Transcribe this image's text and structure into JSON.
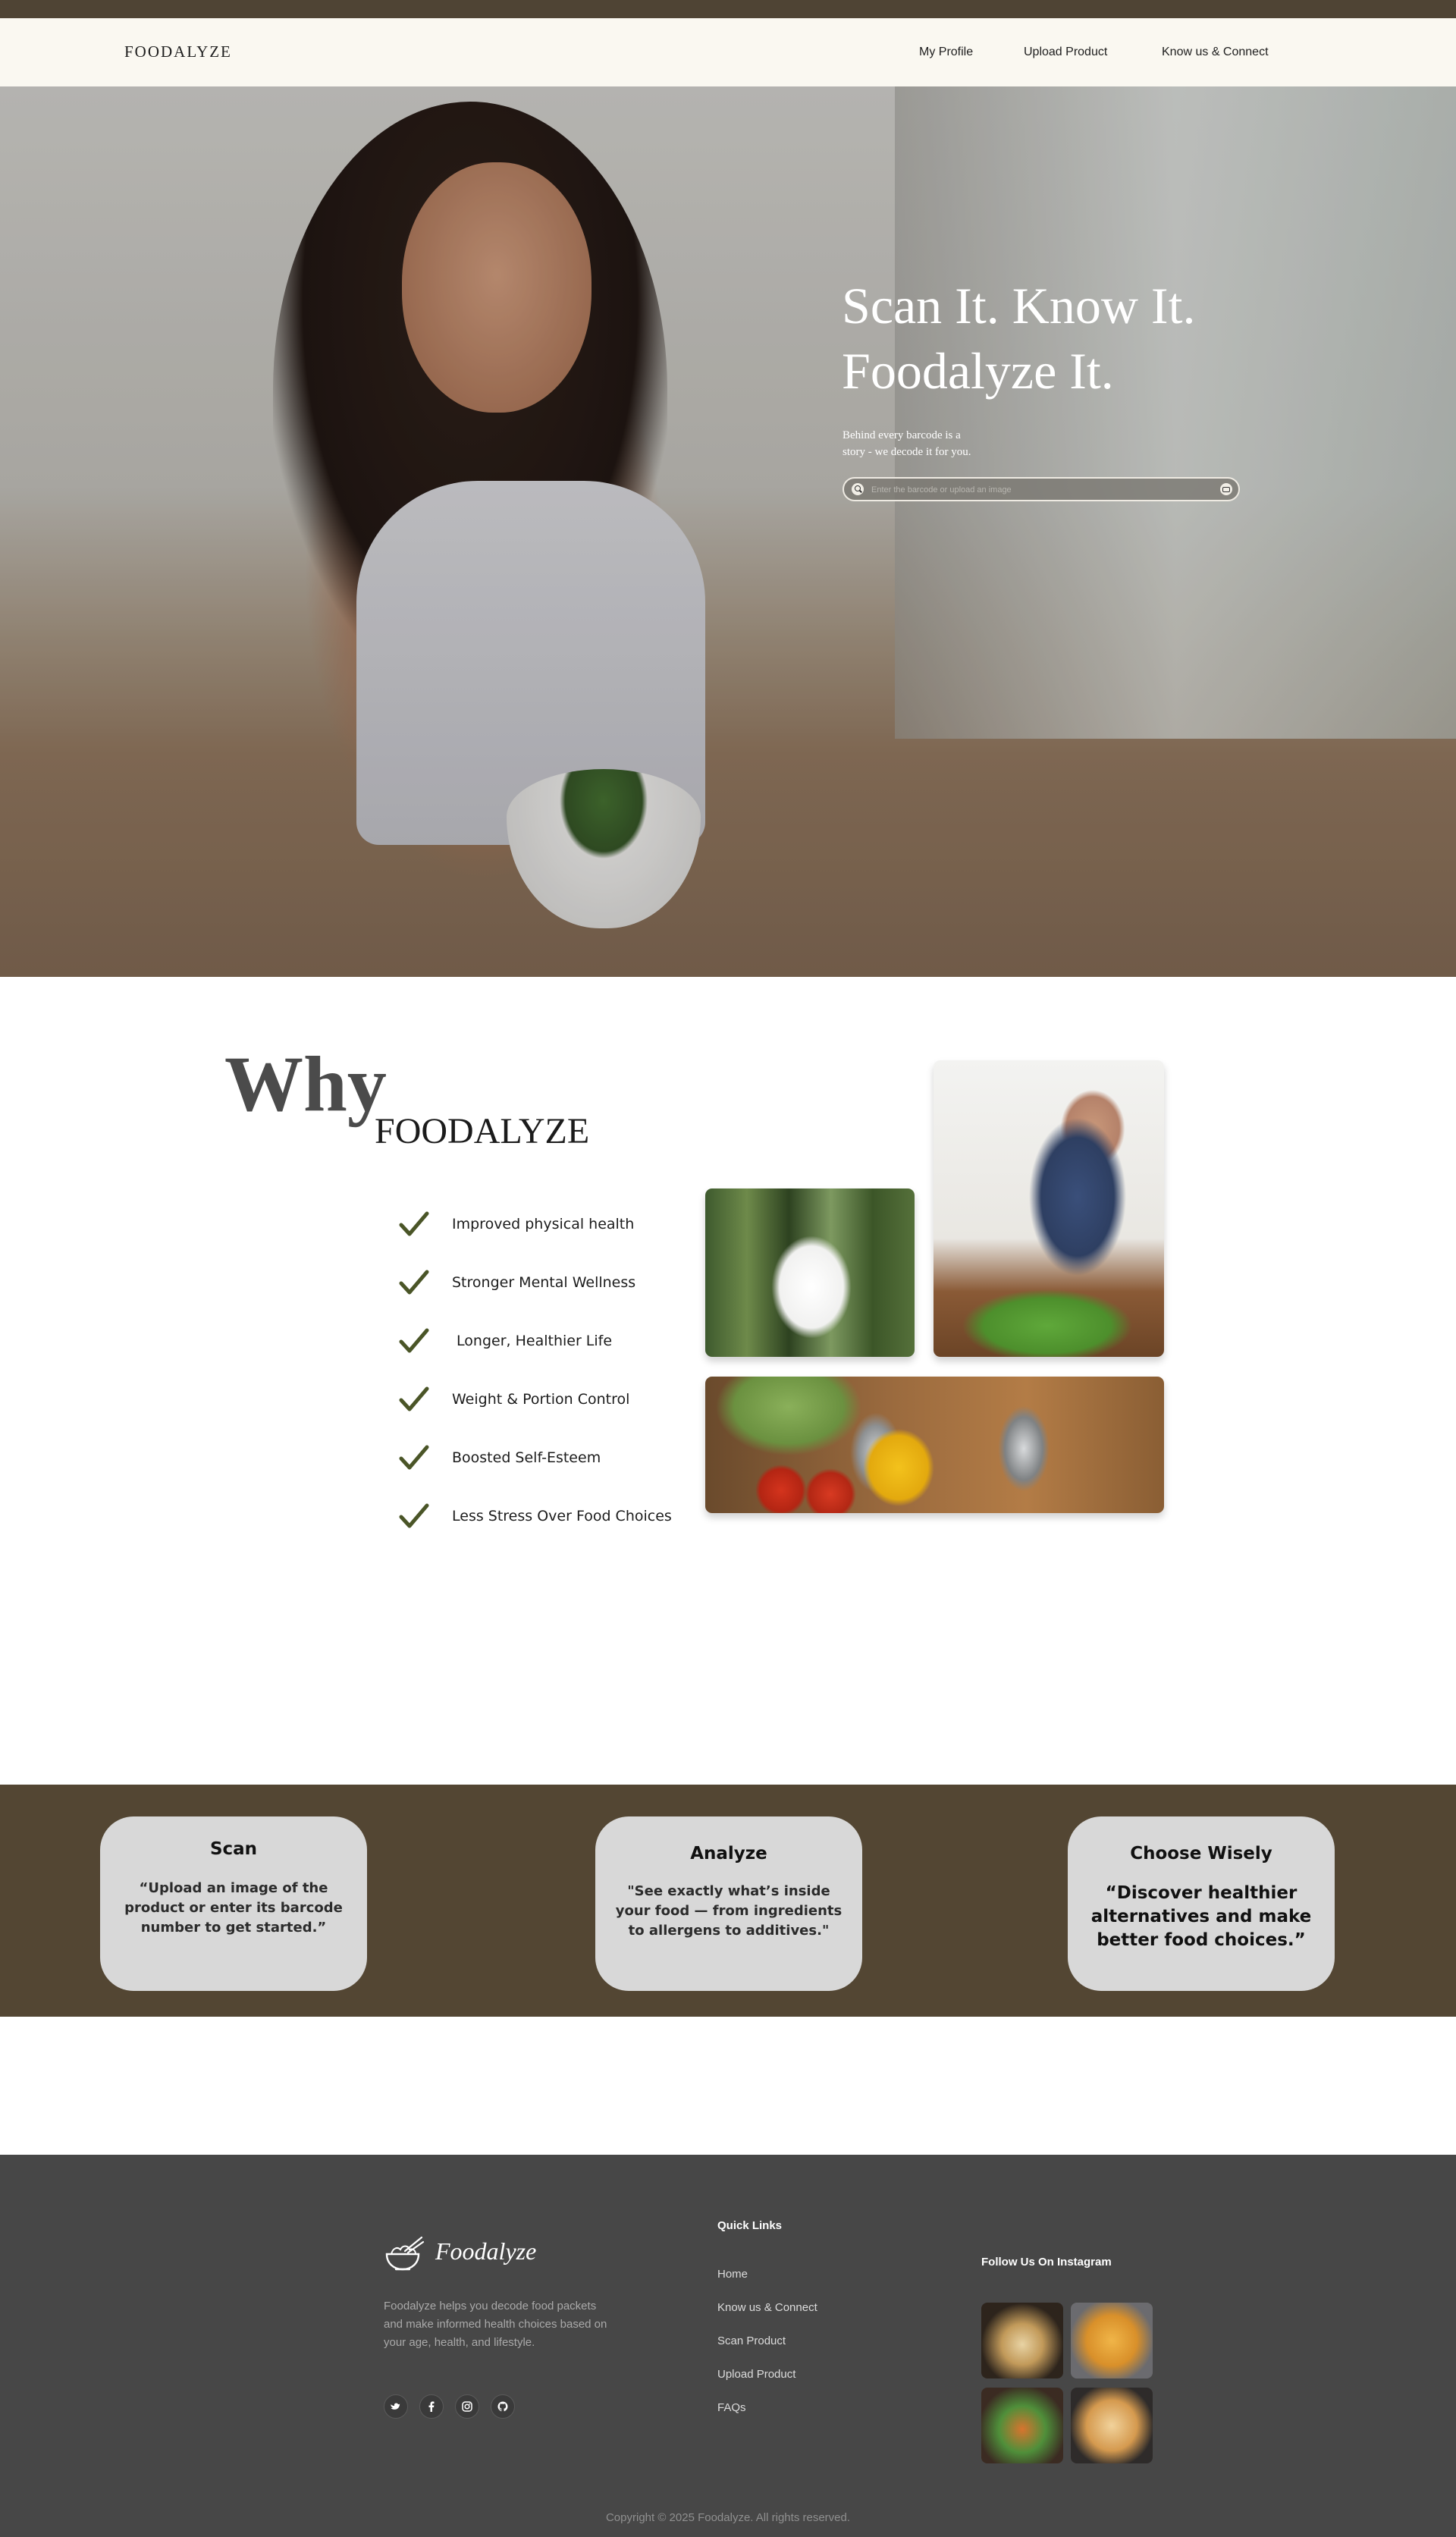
{
  "header": {
    "brand": "FOODALYZE",
    "nav": [
      "My Profile",
      "Upload Product",
      "Know us & Connect"
    ]
  },
  "hero": {
    "title_line1": "Scan It. Know It.",
    "title_line2": "Foodalyze It.",
    "subtitle_line1": "Behind every barcode is a",
    "subtitle_line2": "story - we decode it for you.",
    "search_placeholder": "Enter the barcode or upload an image"
  },
  "why": {
    "big_word": "Why",
    "brand_word": "FOODALYZE",
    "benefits": [
      "Improved physical health",
      "Stronger Mental Wellness",
      " Longer, Healthier Life",
      "Weight & Portion Control",
      "Boosted Self-Esteem",
      "Less Stress Over Food Choices"
    ]
  },
  "process": {
    "cards": [
      {
        "title": "Scan",
        "text": "“Upload an image of the product or enter its barcode number to get started.”"
      },
      {
        "title": "Analyze",
        "text": "\"See exactly what’s inside your food — from ingredients to allergens to additives.\""
      },
      {
        "title": "Choose Wisely",
        "text": "“Discover healthier alternatives and make better food choices.”"
      }
    ]
  },
  "footer": {
    "logo_text": "Foodalyze",
    "about": "Foodalyze helps you decode food packets and make informed health choices based on your age, health, and lifestyle.",
    "quick_links_heading": "Quick Links",
    "quick_links": [
      "Home",
      "Know us & Connect",
      "Scan Product",
      "Upload Product",
      "FAQs"
    ],
    "instagram_heading": "Follow Us On Instagram",
    "social_icons": [
      "twitter-icon",
      "facebook-icon",
      "instagram-icon",
      "github-icon"
    ],
    "copyright": "Copyright © 2025 Foodalyze. All rights reserved."
  },
  "colors": {
    "top_strip": "#4f4434",
    "header_bg": "#faf8f1",
    "band_bg": "#534633",
    "card_bg": "#d8d8d8",
    "check": "#4a5527",
    "footer_bg": "#474747"
  }
}
